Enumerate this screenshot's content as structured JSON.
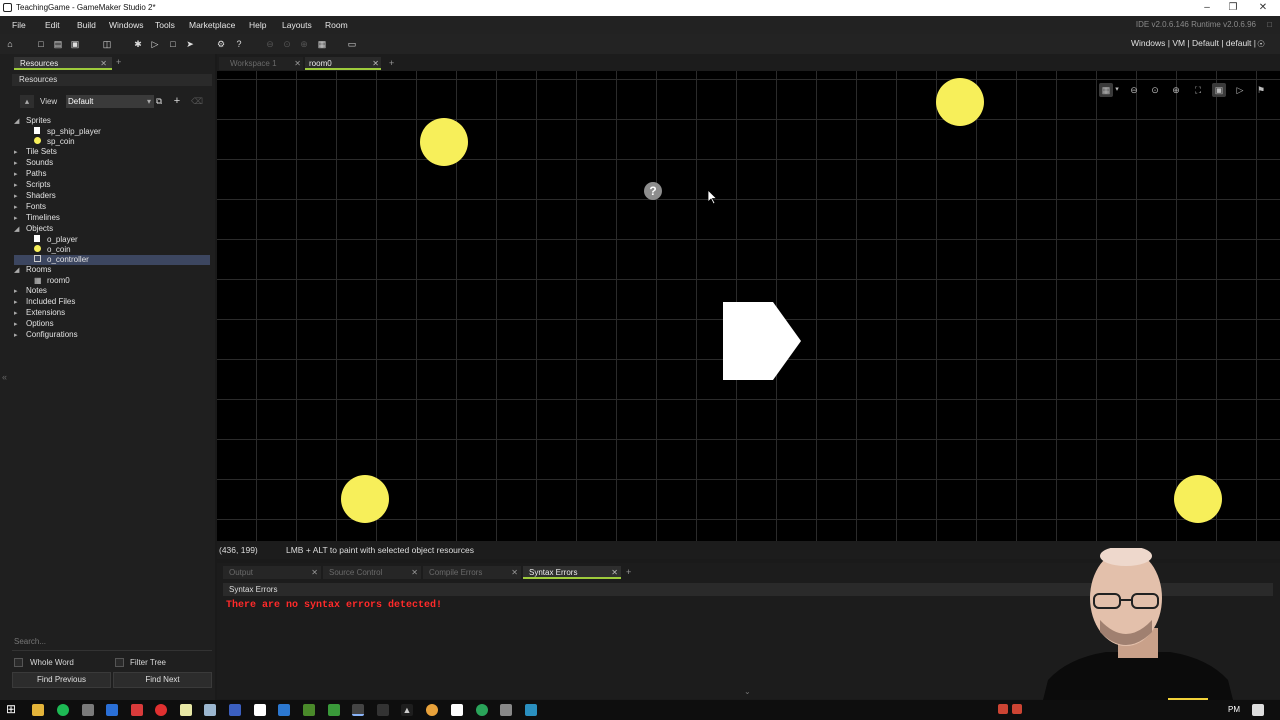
{
  "titlebar": {
    "title": "TeachingGame - GameMaker Studio 2*"
  },
  "menu": {
    "items": [
      "File",
      "Edit",
      "Build",
      "Windows",
      "Tools",
      "Marketplace",
      "Help",
      "Layouts",
      "Room"
    ],
    "ide_version": "IDE v2.0.6.146 Runtime v2.0.6.96"
  },
  "toolbar": {
    "target_info": "Windows | VM | Default | default |"
  },
  "resources": {
    "tab_label": "Resources",
    "header": "Resources",
    "view_label": "View",
    "view_value": "Default",
    "tree": [
      {
        "label": "Sprites",
        "level": 0,
        "arrow": "open"
      },
      {
        "label": "sp_ship_player",
        "level": 1,
        "icon": "white"
      },
      {
        "label": "sp_coin",
        "level": 1,
        "icon": "coin"
      },
      {
        "label": "Tile Sets",
        "level": 0,
        "arrow": "closed"
      },
      {
        "label": "Sounds",
        "level": 0,
        "arrow": "closed"
      },
      {
        "label": "Paths",
        "level": 0,
        "arrow": "closed"
      },
      {
        "label": "Scripts",
        "level": 0,
        "arrow": "closed"
      },
      {
        "label": "Shaders",
        "level": 0,
        "arrow": "closed"
      },
      {
        "label": "Fonts",
        "level": 0,
        "arrow": "closed"
      },
      {
        "label": "Timelines",
        "level": 0,
        "arrow": "closed"
      },
      {
        "label": "Objects",
        "level": 0,
        "arrow": "open"
      },
      {
        "label": "o_player",
        "level": 1,
        "icon": "white"
      },
      {
        "label": "o_coin",
        "level": 1,
        "icon": "coin"
      },
      {
        "label": "o_controller",
        "level": 1,
        "icon": "empty",
        "selected": true
      },
      {
        "label": "Rooms",
        "level": 0,
        "arrow": "open"
      },
      {
        "label": "room0",
        "level": 1,
        "icon": "room"
      },
      {
        "label": "Notes",
        "level": 0,
        "arrow": "closed"
      },
      {
        "label": "Included Files",
        "level": 0,
        "arrow": "closed"
      },
      {
        "label": "Extensions",
        "level": 0,
        "arrow": "closed"
      },
      {
        "label": "Options",
        "level": 0,
        "arrow": "closed"
      },
      {
        "label": "Configurations",
        "level": 0,
        "arrow": "closed"
      }
    ],
    "search_placeholder": "Search...",
    "whole_word": "Whole Word",
    "filter_tree": "Filter Tree",
    "find_previous": "Find Previous",
    "find_next": "Find Next"
  },
  "editor": {
    "tabs": [
      {
        "label": "Workspace 1",
        "active": false
      },
      {
        "label": "room0",
        "active": true
      }
    ]
  },
  "status": {
    "coords": "(436, 199)",
    "hint": "LMB + ALT to paint with selected object resources"
  },
  "output": {
    "tabs": [
      {
        "label": "Output",
        "active": false
      },
      {
        "label": "Source Control",
        "active": false
      },
      {
        "label": "Compile Errors",
        "active": false
      },
      {
        "label": "Syntax Errors",
        "active": true
      }
    ],
    "header": "Syntax Errors",
    "message": "There are no syntax errors detected!"
  },
  "colors": {
    "accent": "#9ecb3c",
    "coin": "#f7ef5a",
    "error_text": "#ff2a2a",
    "selection": "#3c4660"
  }
}
